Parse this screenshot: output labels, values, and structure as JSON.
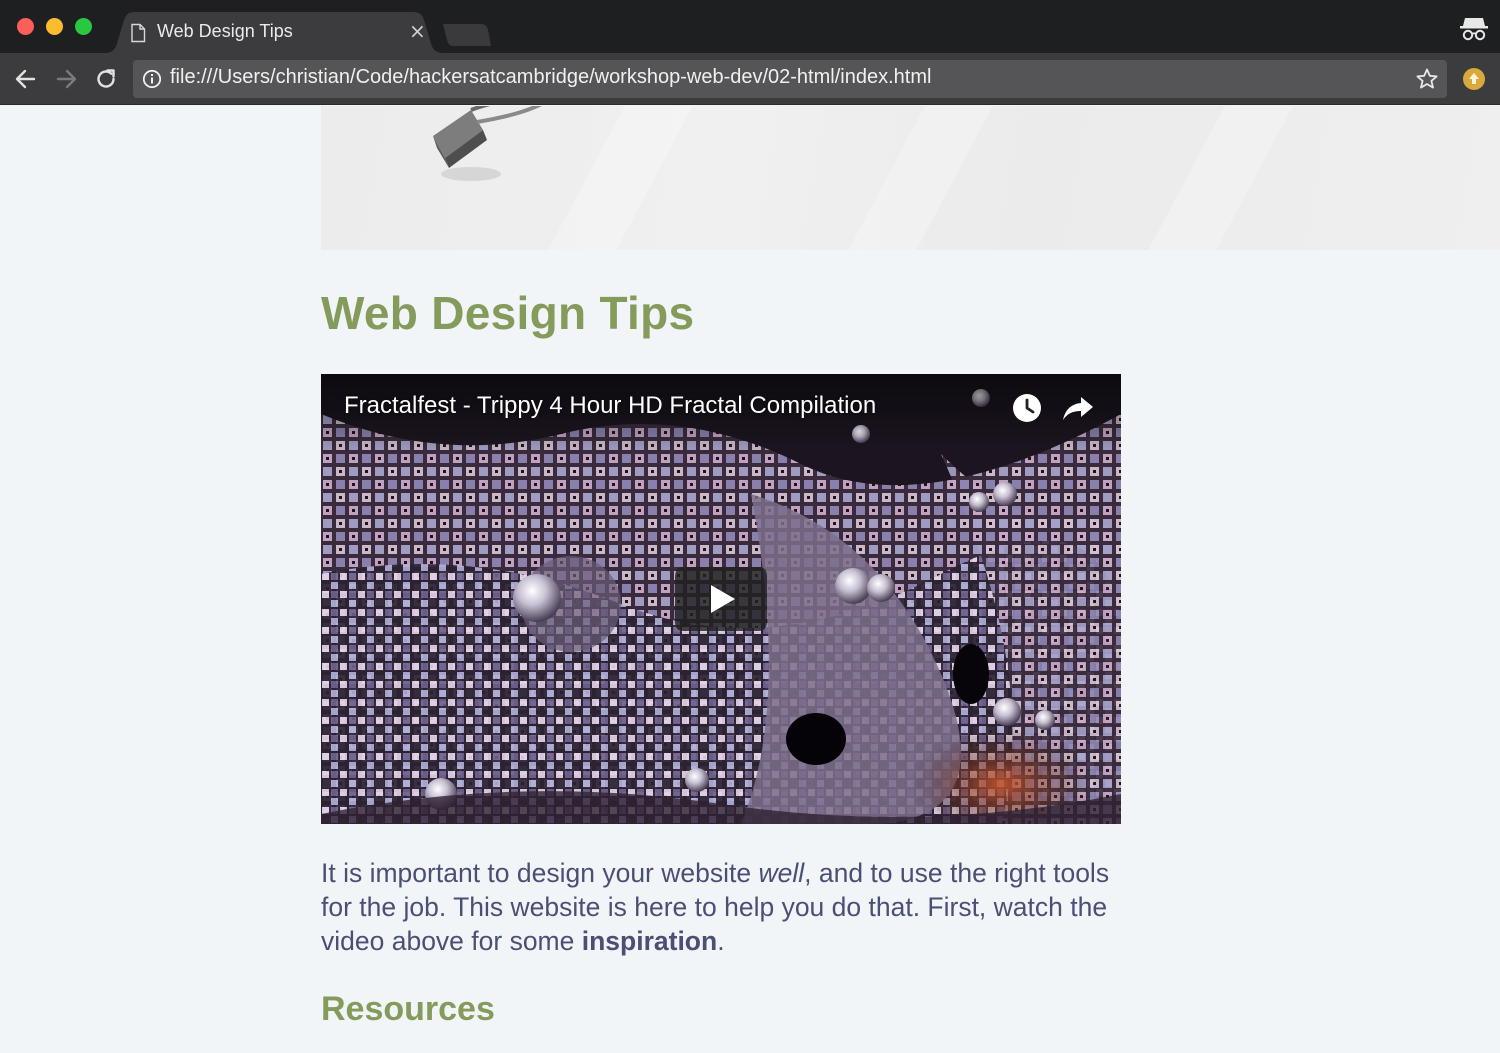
{
  "browser": {
    "tab": {
      "title": "Web Design Tips",
      "close_glyph": "×"
    },
    "address_bar": {
      "url": "file:///Users/christian/Code/hackersatcambridge/workshop-web-dev/02-html/index.html"
    },
    "icons": {
      "back": "arrow-left-icon",
      "forward": "arrow-right-icon",
      "reload": "reload-icon",
      "info": "info-icon",
      "bookmark": "star-icon",
      "extension": "extension-icon",
      "incognito": "incognito-icon",
      "tab_page": "document-icon"
    }
  },
  "page": {
    "title": "Web Design Tips",
    "video": {
      "title": "Fractalfest - Trippy 4 Hour HD Fractal Compilation",
      "controls": [
        "watch-later-icon",
        "share-icon",
        "play-icon"
      ]
    },
    "intro": {
      "part1": "It is important to design your website ",
      "emphasis": "well",
      "part2": ", and to use the right tools for the job. This website is here to help you do that. First, watch the video above for some ",
      "strong": "inspiration",
      "part3": "."
    },
    "resources_heading": "Resources"
  },
  "colors": {
    "heading_green": "#849b5b",
    "body_text": "#4b4f74",
    "page_background": "#f1f5f8",
    "chrome_dark": "#1e1f21",
    "toolbar": "#3c3c3e"
  }
}
